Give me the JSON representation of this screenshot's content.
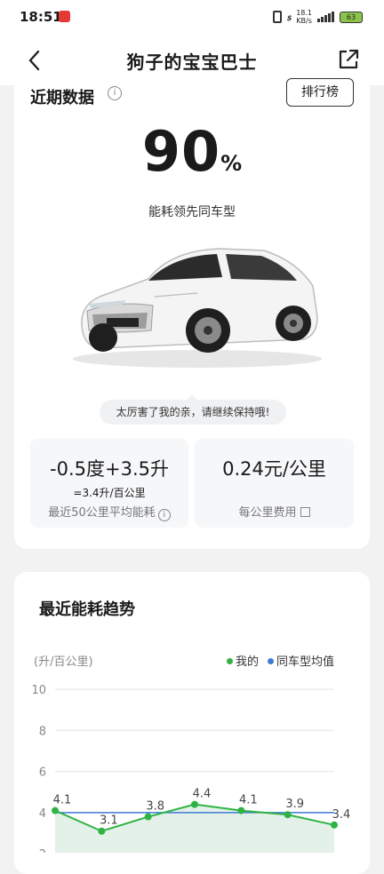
{
  "status_bar": {
    "time": "18:51",
    "net_speed_value": "18.1",
    "net_speed_unit": "KB/s",
    "battery": "63"
  },
  "nav": {
    "title": "狗子的宝宝巴士"
  },
  "recent": {
    "title": "近期数据",
    "info_glyph": "i",
    "rank_button": "排行榜",
    "percent_value": "90",
    "percent_sign": "%",
    "lead_text": "能耗领先同车型",
    "praise": "太厉害了我的亲，请继续保持哦!",
    "stat_consumption": {
      "main": "-0.5度+3.5升",
      "sub": "=3.4升/百公里",
      "caption": "最近50公里平均能耗"
    },
    "stat_cost": {
      "main": "0.24元/公里",
      "caption": "每公里费用"
    }
  },
  "trend": {
    "title": "最近能耗趋势",
    "legend_mine": "我的",
    "legend_avg": "同车型均值"
  },
  "colors": {
    "mine": "#2fb344",
    "avg": "#3d7ad6",
    "area": "#dceee3"
  },
  "chart_data": {
    "type": "line",
    "unit_label": "(升/百公里)",
    "y_ticks": [
      "10",
      "8",
      "6",
      "4",
      "2"
    ],
    "ylim": [
      2,
      10
    ],
    "grid": true,
    "legend_position": "top-right",
    "series": [
      {
        "name": "我的",
        "values": [
          4.1,
          3.1,
          3.8,
          4.4,
          4.1,
          3.9,
          3.4
        ],
        "labels": [
          "4.1",
          "3.1",
          "3.8",
          "4.4",
          "4.1",
          "3.9",
          "3.4"
        ]
      },
      {
        "name": "同车型均值",
        "values": [
          4.0,
          4.0,
          4.0,
          4.0,
          4.0,
          4.0,
          4.0
        ]
      }
    ]
  }
}
